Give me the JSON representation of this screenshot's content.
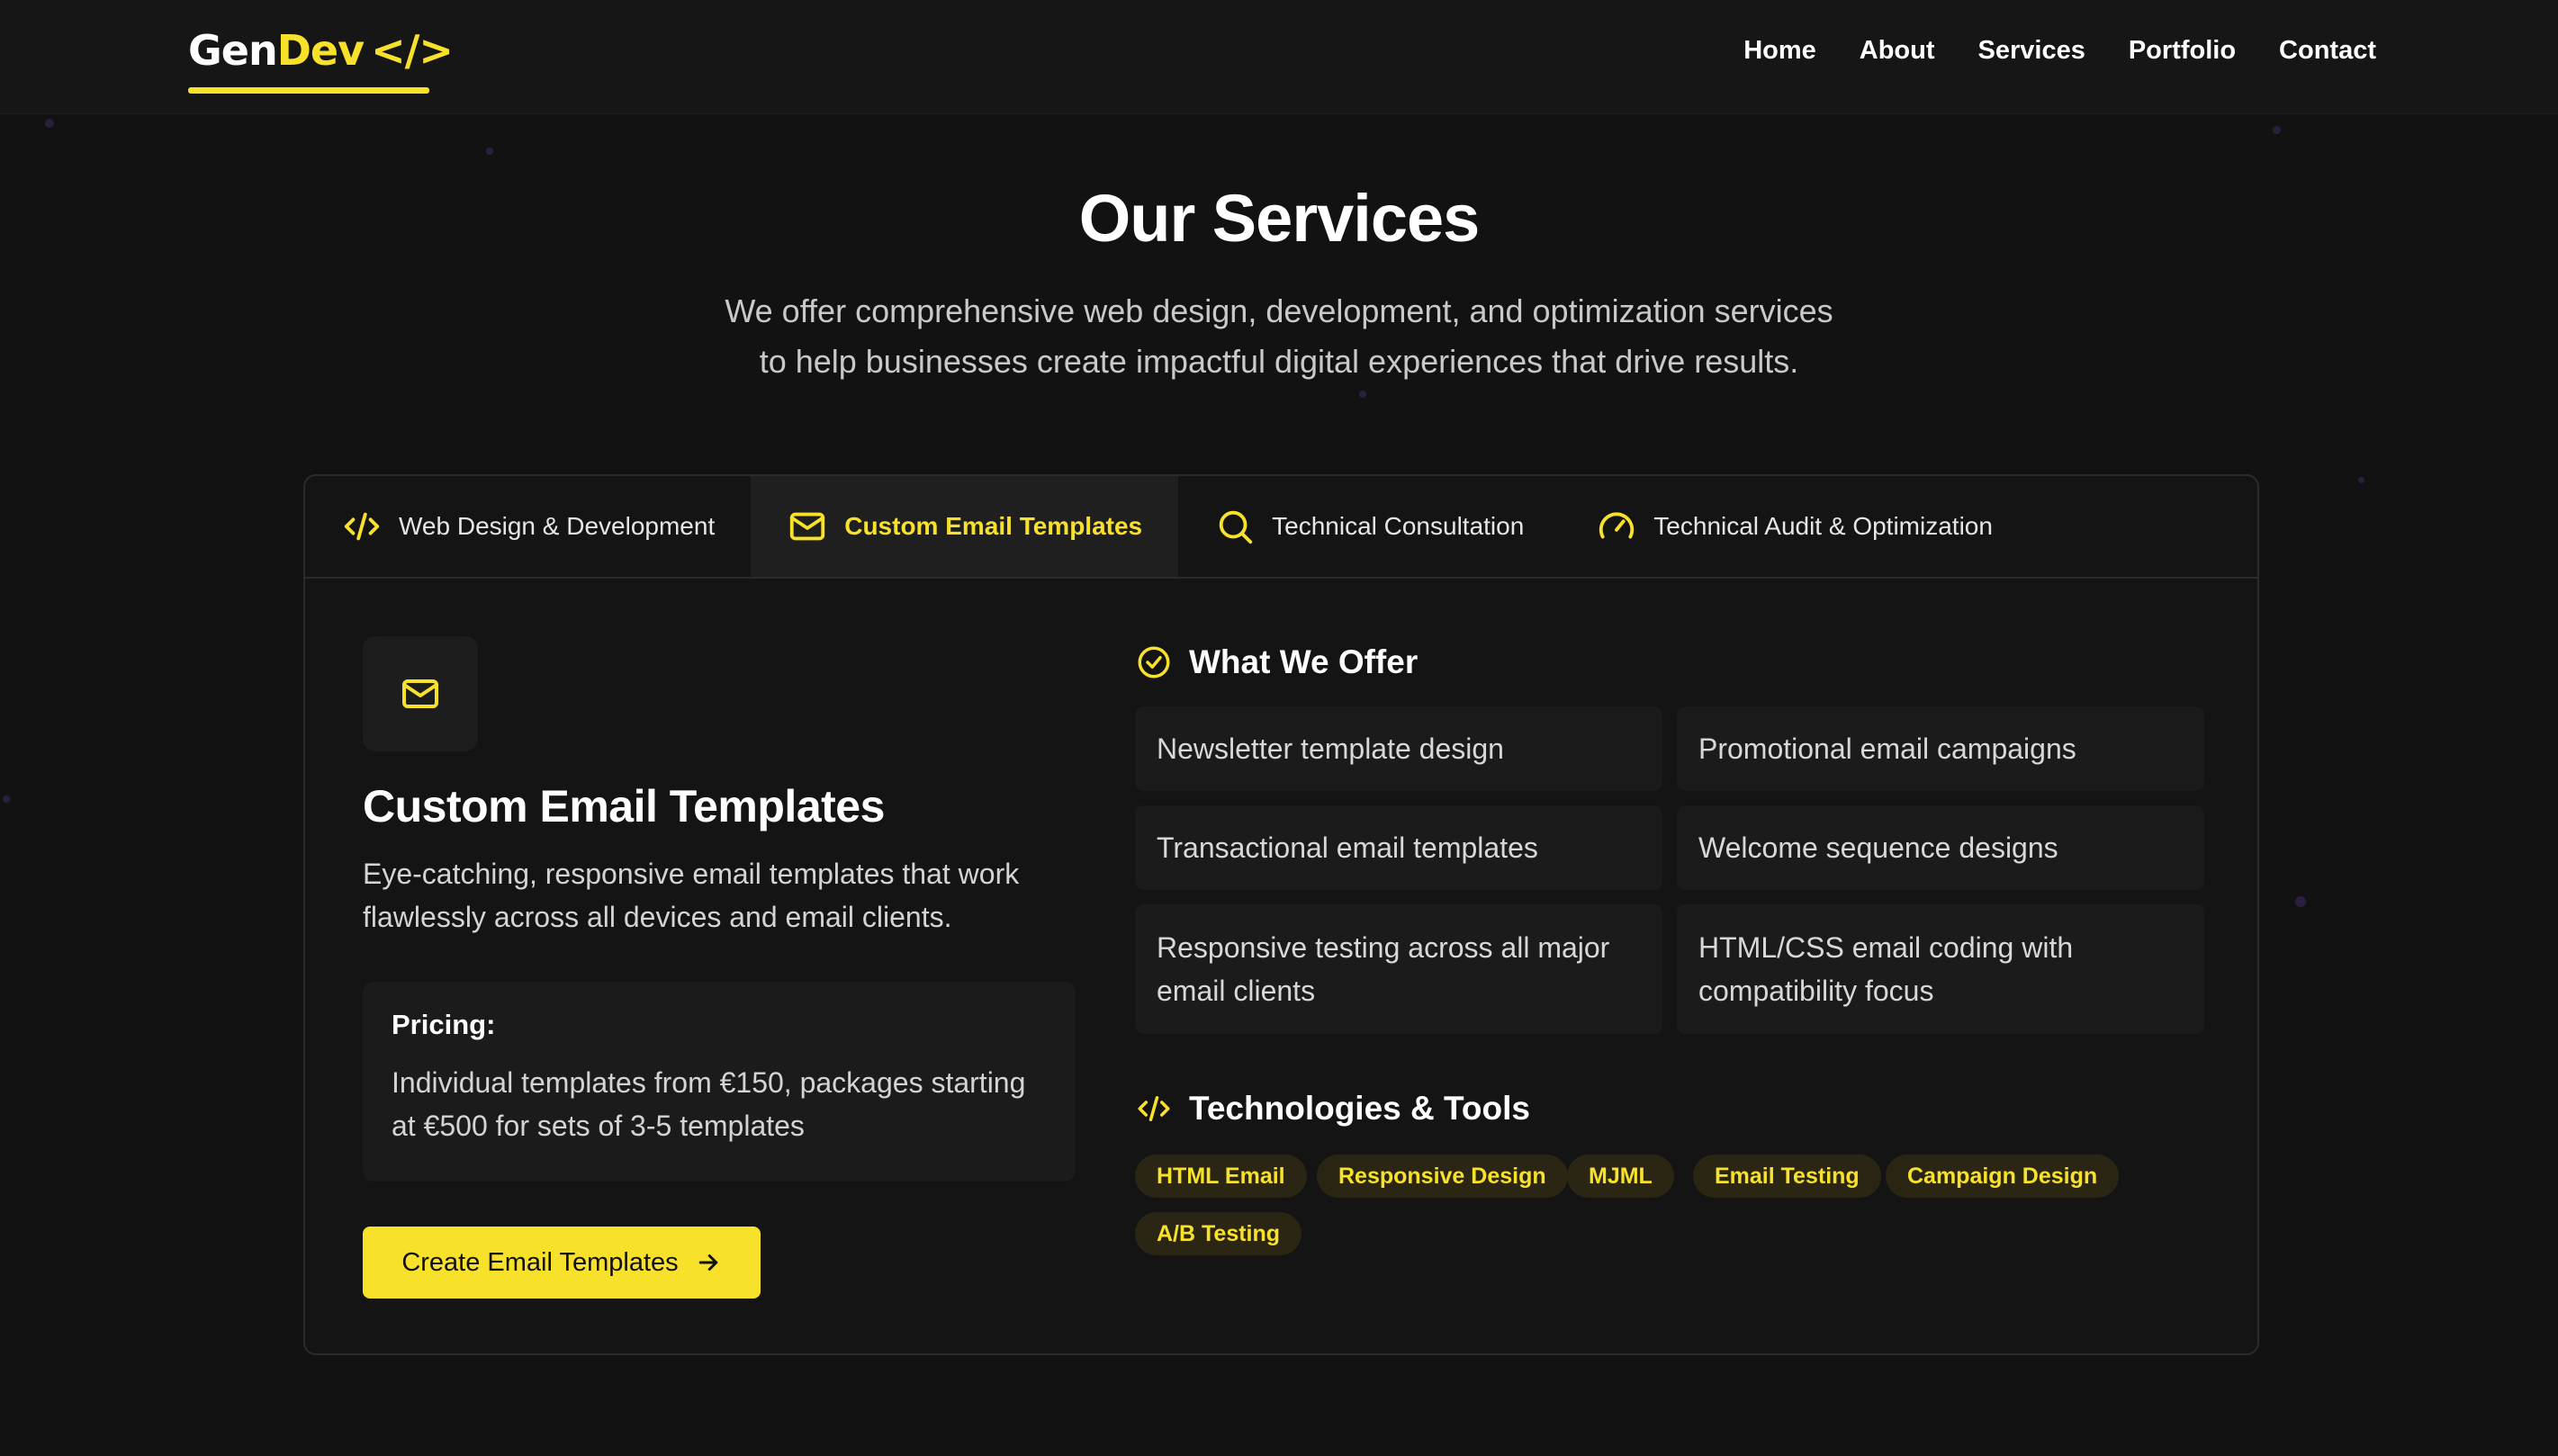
{
  "brand": {
    "gen": "Gen",
    "dev": "Dev",
    "code": "</>",
    "accent": "#f8e12b"
  },
  "nav": [
    "Home",
    "About",
    "Services",
    "Portfolio",
    "Contact"
  ],
  "hero": {
    "title": "Our Services",
    "subtitle_line1": "We offer comprehensive web design, development, and optimization services",
    "subtitle_line2": "to help businesses create impactful digital experiences that drive results."
  },
  "tabs": [
    {
      "label": "Web Design & Development",
      "icon": "code-icon",
      "active": false
    },
    {
      "label": "Custom Email Templates",
      "icon": "mail-icon",
      "active": true
    },
    {
      "label": "Technical Consultation",
      "icon": "search-icon",
      "active": false
    },
    {
      "label": "Technical Audit & Optimization",
      "icon": "gauge-icon",
      "active": false
    }
  ],
  "service": {
    "title": "Custom Email Templates",
    "description": "Eye-catching, responsive email templates that work flawlessly across all devices and email clients.",
    "pricing_label": "Pricing:",
    "pricing_text": "Individual templates from €150, packages starting at €500 for sets of 3-5 templates",
    "cta_label": "Create Email Templates"
  },
  "offer": {
    "heading": "What We Offer",
    "items": [
      "Newsletter template design",
      "Promotional email campaigns",
      "Transactional email templates",
      "Welcome sequence designs",
      "Responsive testing across all major email clients",
      "HTML/CSS email coding with compatibility focus"
    ]
  },
  "tech": {
    "heading": "Technologies & Tools",
    "tags": [
      "HTML Email",
      "Responsive Design",
      "MJML",
      "Email Testing",
      "Campaign Design",
      "A/B Testing"
    ]
  }
}
